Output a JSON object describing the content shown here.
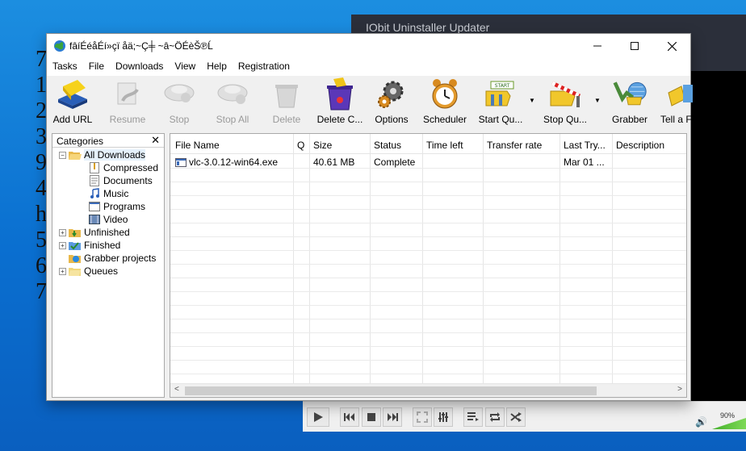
{
  "background": {
    "digits": [
      "7",
      "1",
      "2",
      "3",
      "9",
      "4",
      "h",
      "5",
      "6",
      "7"
    ]
  },
  "iobit": {
    "title": "IObit Uninstaller Updater"
  },
  "vlc": {
    "volume": "90%"
  },
  "idm": {
    "title": "fâíÉéåÉí»çï åä;~Ç╪ ~â~ÖÉèŠ℗Ĺ",
    "menu": [
      "Tasks",
      "File",
      "Downloads",
      "View",
      "Help",
      "Registration"
    ],
    "toolbar": {
      "add_url": "Add URL",
      "resume": "Resume",
      "stop": "Stop",
      "stop_all": "Stop All",
      "delete": "Delete",
      "delete_completed": "Delete C...",
      "options": "Options",
      "scheduler": "Scheduler",
      "start_queue": "Start Qu...",
      "stop_queue": "Stop Qu...",
      "grabber": "Grabber",
      "tell_friend": "Tell a Fr"
    },
    "categories": {
      "header": "Categories",
      "items": [
        {
          "label": "All Downloads"
        },
        {
          "label": "Compressed"
        },
        {
          "label": "Documents"
        },
        {
          "label": "Music"
        },
        {
          "label": "Programs"
        },
        {
          "label": "Video"
        },
        {
          "label": "Unfinished"
        },
        {
          "label": "Finished"
        },
        {
          "label": "Grabber projects"
        },
        {
          "label": "Queues"
        }
      ]
    },
    "columns": [
      "File Name",
      "Q",
      "Size",
      "Status",
      "Time left",
      "Transfer rate",
      "Last Try...",
      "Description"
    ],
    "rows": [
      {
        "file_name": "vlc-3.0.12-win64.exe",
        "q": "",
        "size": "40.61  MB",
        "status": "Complete",
        "time_left": "",
        "transfer_rate": "",
        "last_try": "Mar 01 ...",
        "description": ""
      }
    ]
  }
}
